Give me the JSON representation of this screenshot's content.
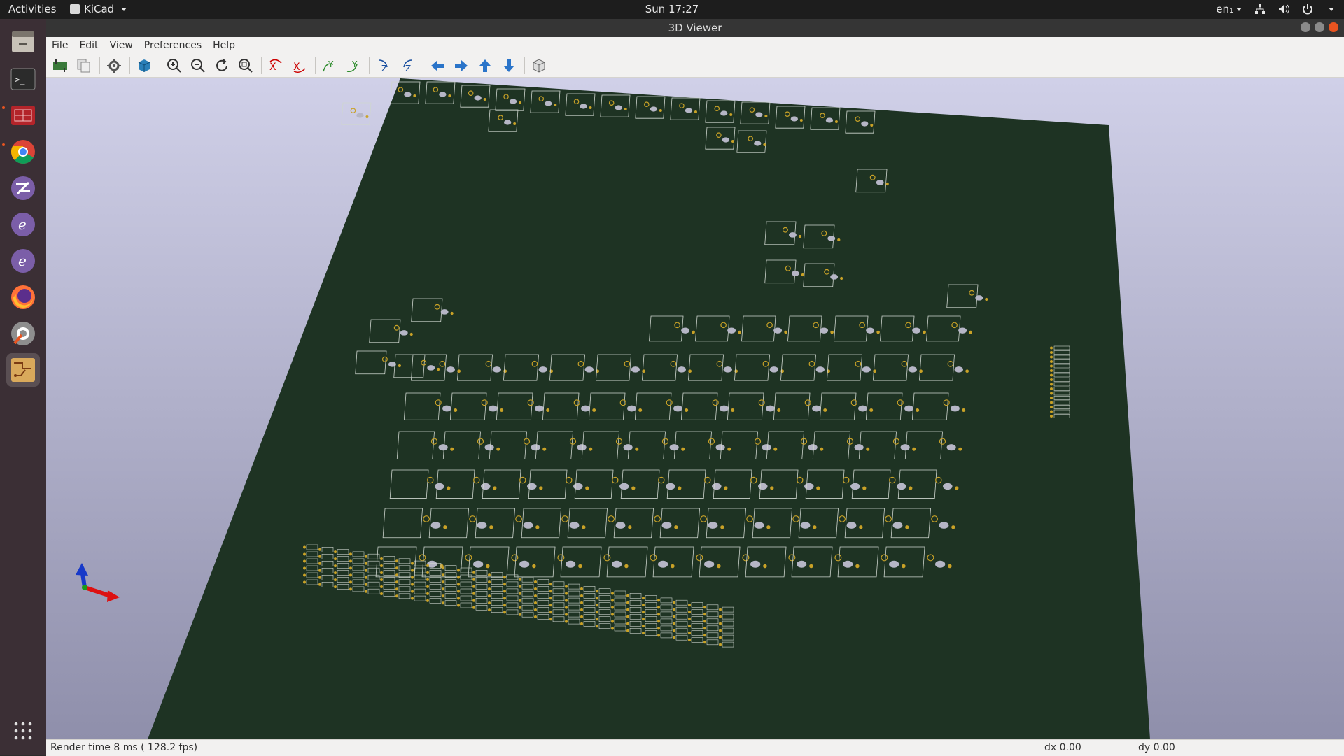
{
  "topbar": {
    "activities": "Activities",
    "app_name": "KiCad",
    "clock": "Sun 17:27",
    "keyboard": "en₁"
  },
  "window": {
    "title": "3D Viewer"
  },
  "menu": [
    "File",
    "Edit",
    "View",
    "Preferences",
    "Help"
  ],
  "toolbar": {
    "icons": [
      "reload-board-icon",
      "copy-3d-image-icon",
      "raytracing-settings-icon",
      "render-mode-icon",
      "zoom-in-icon",
      "zoom-out-icon",
      "redraw-icon",
      "zoom-fit-icon",
      "rotate-x-cw-icon",
      "rotate-x-ccw-icon",
      "rotate-y-cw-icon",
      "rotate-y-ccw-icon",
      "rotate-z-cw-icon",
      "rotate-z-ccw-icon",
      "move-left-icon",
      "move-right-icon",
      "move-up-icon",
      "move-down-icon",
      "orthographic-icon"
    ]
  },
  "statusbar": {
    "render_time": "Render time 8 ms ( 128.2 fps)",
    "dx": "dx 0.00",
    "dy": "dy 0.00"
  },
  "colors": {
    "board": "#1e3323",
    "footprint_outline": "#cfd6cf",
    "pad": "#c9a227",
    "accent": "#e95420"
  },
  "dock": [
    "files-icon",
    "terminal-icon",
    "kicad-bom-icon",
    "chrome-icon",
    "emacs-icon",
    "emacs-icon-2",
    "emacs-icon-3",
    "firefox-icon",
    "settings-icon",
    "pcbnew-icon"
  ]
}
